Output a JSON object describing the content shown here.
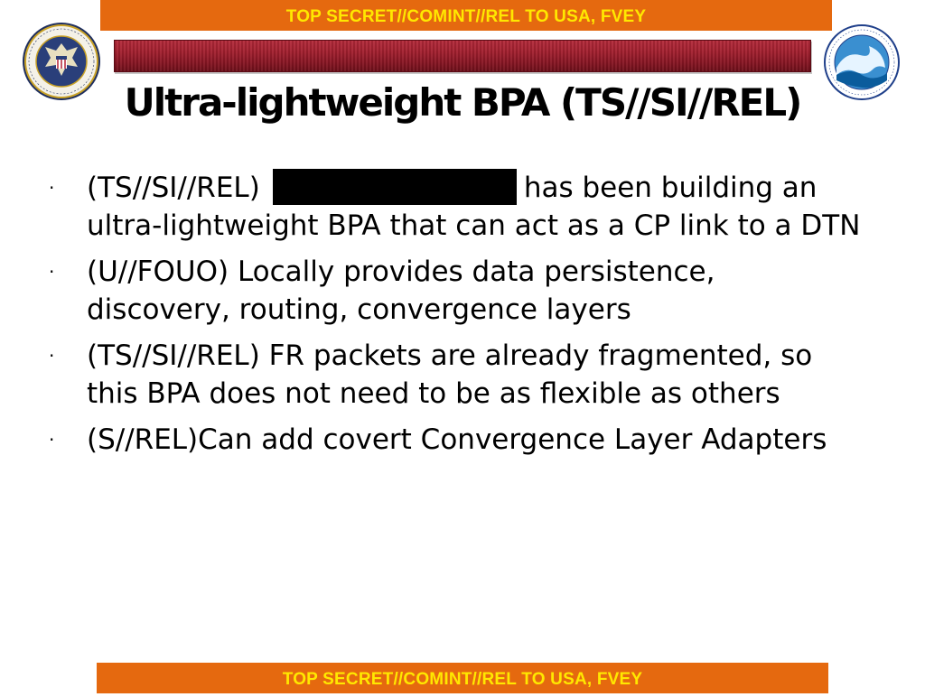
{
  "classification": {
    "top_banner": "TOP SECRET//COMINT//REL TO USA, FVEY",
    "bottom_banner": "TOP SECRET//COMINT//REL TO USA, FVEY",
    "banner_bg": "#e5690f",
    "banner_text": "#ffe800"
  },
  "header": {
    "title": "Ultra-lightweight BPA (TS//SI//REL)",
    "left_logo": "nsa-seal",
    "right_logo": "directorate-wave-seal",
    "bar_color": "#a4202f"
  },
  "bullets": [
    {
      "marker": "·",
      "prefix": "(TS//SI//REL)",
      "redacted": true,
      "text": "has been building an ultra-lightweight BPA that can act as a CP link to a DTN"
    },
    {
      "marker": "·",
      "text": "(U//FOUO) Locally provides data persistence, discovery, routing, convergence layers"
    },
    {
      "marker": "·",
      "text": "(TS//SI//REL) FR packets are already fragmented, so this BPA does not need to be as flexible as others"
    },
    {
      "marker": "·",
      "text": "(S//REL)Can add covert Convergence Layer Adapters"
    }
  ]
}
